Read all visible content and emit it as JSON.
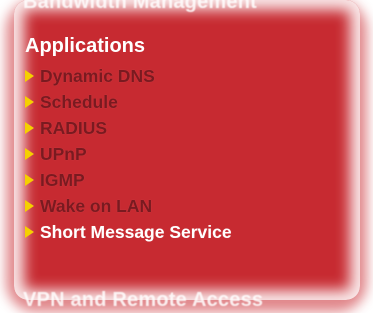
{
  "menu": {
    "above_header": "Bandwidth Management",
    "section_title": "Applications",
    "items": [
      {
        "label": "Dynamic DNS"
      },
      {
        "label": "Schedule"
      },
      {
        "label": "RADIUS"
      },
      {
        "label": "UPnP"
      },
      {
        "label": "IGMP"
      },
      {
        "label": "Wake on LAN"
      },
      {
        "label": "Short Message Service"
      }
    ],
    "below_header": "VPN and Remote Access"
  },
  "colors": {
    "panel": "#c72a31",
    "arrow": "#f5d000",
    "item_text": "#7a1a20",
    "active_text": "#ffffff"
  },
  "icons": {
    "bullet": "triangle-right-icon"
  }
}
